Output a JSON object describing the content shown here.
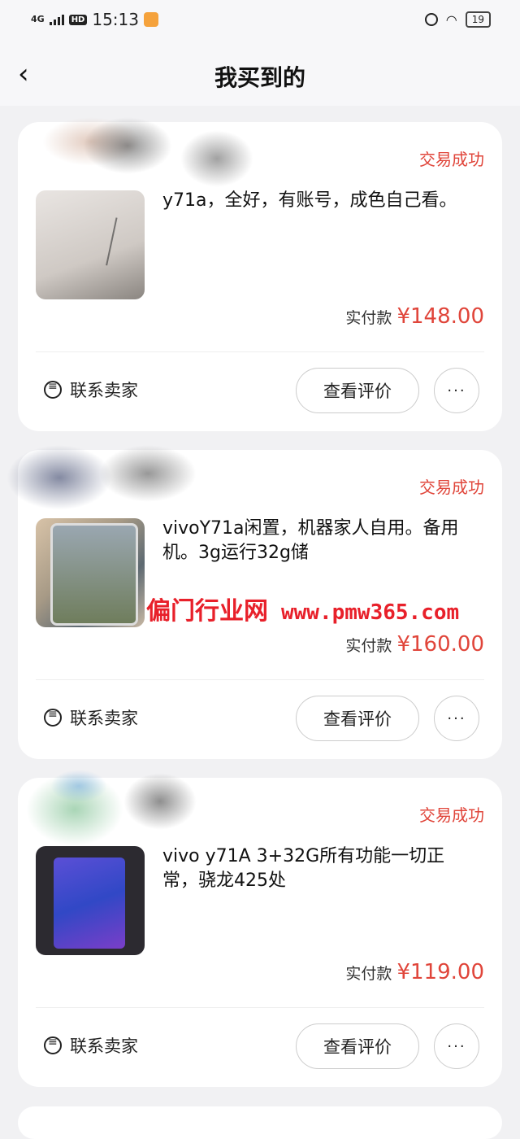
{
  "status_bar": {
    "network": "4G",
    "hd": "HD",
    "time": "15:13",
    "battery": "19"
  },
  "header": {
    "title": "我买到的"
  },
  "orders": [
    {
      "status": "交易成功",
      "description": "y71a，全好，有账号，成色自己看。",
      "price_label": "实付款",
      "price": "¥148.00",
      "contact_label": "联系卖家",
      "review_label": "查看评价",
      "more_label": "···"
    },
    {
      "status": "交易成功",
      "description": "vivoY71a闲置，机器家人自用。备用机。3g运行32g储",
      "price_label": "实付款",
      "price": "¥160.00",
      "contact_label": "联系卖家",
      "review_label": "查看评价",
      "more_label": "···"
    },
    {
      "status": "交易成功",
      "description": "vivo y71A 3+32G所有功能一切正常，骁龙425处",
      "price_label": "实付款",
      "price": "¥119.00",
      "contact_label": "联系卖家",
      "review_label": "查看评价",
      "more_label": "···"
    }
  ],
  "watermark": {
    "text": "偏门行业网",
    "url": "www.pmw365.com"
  },
  "colors": {
    "accent": "#e0453a",
    "background": "#f1f1f3"
  }
}
